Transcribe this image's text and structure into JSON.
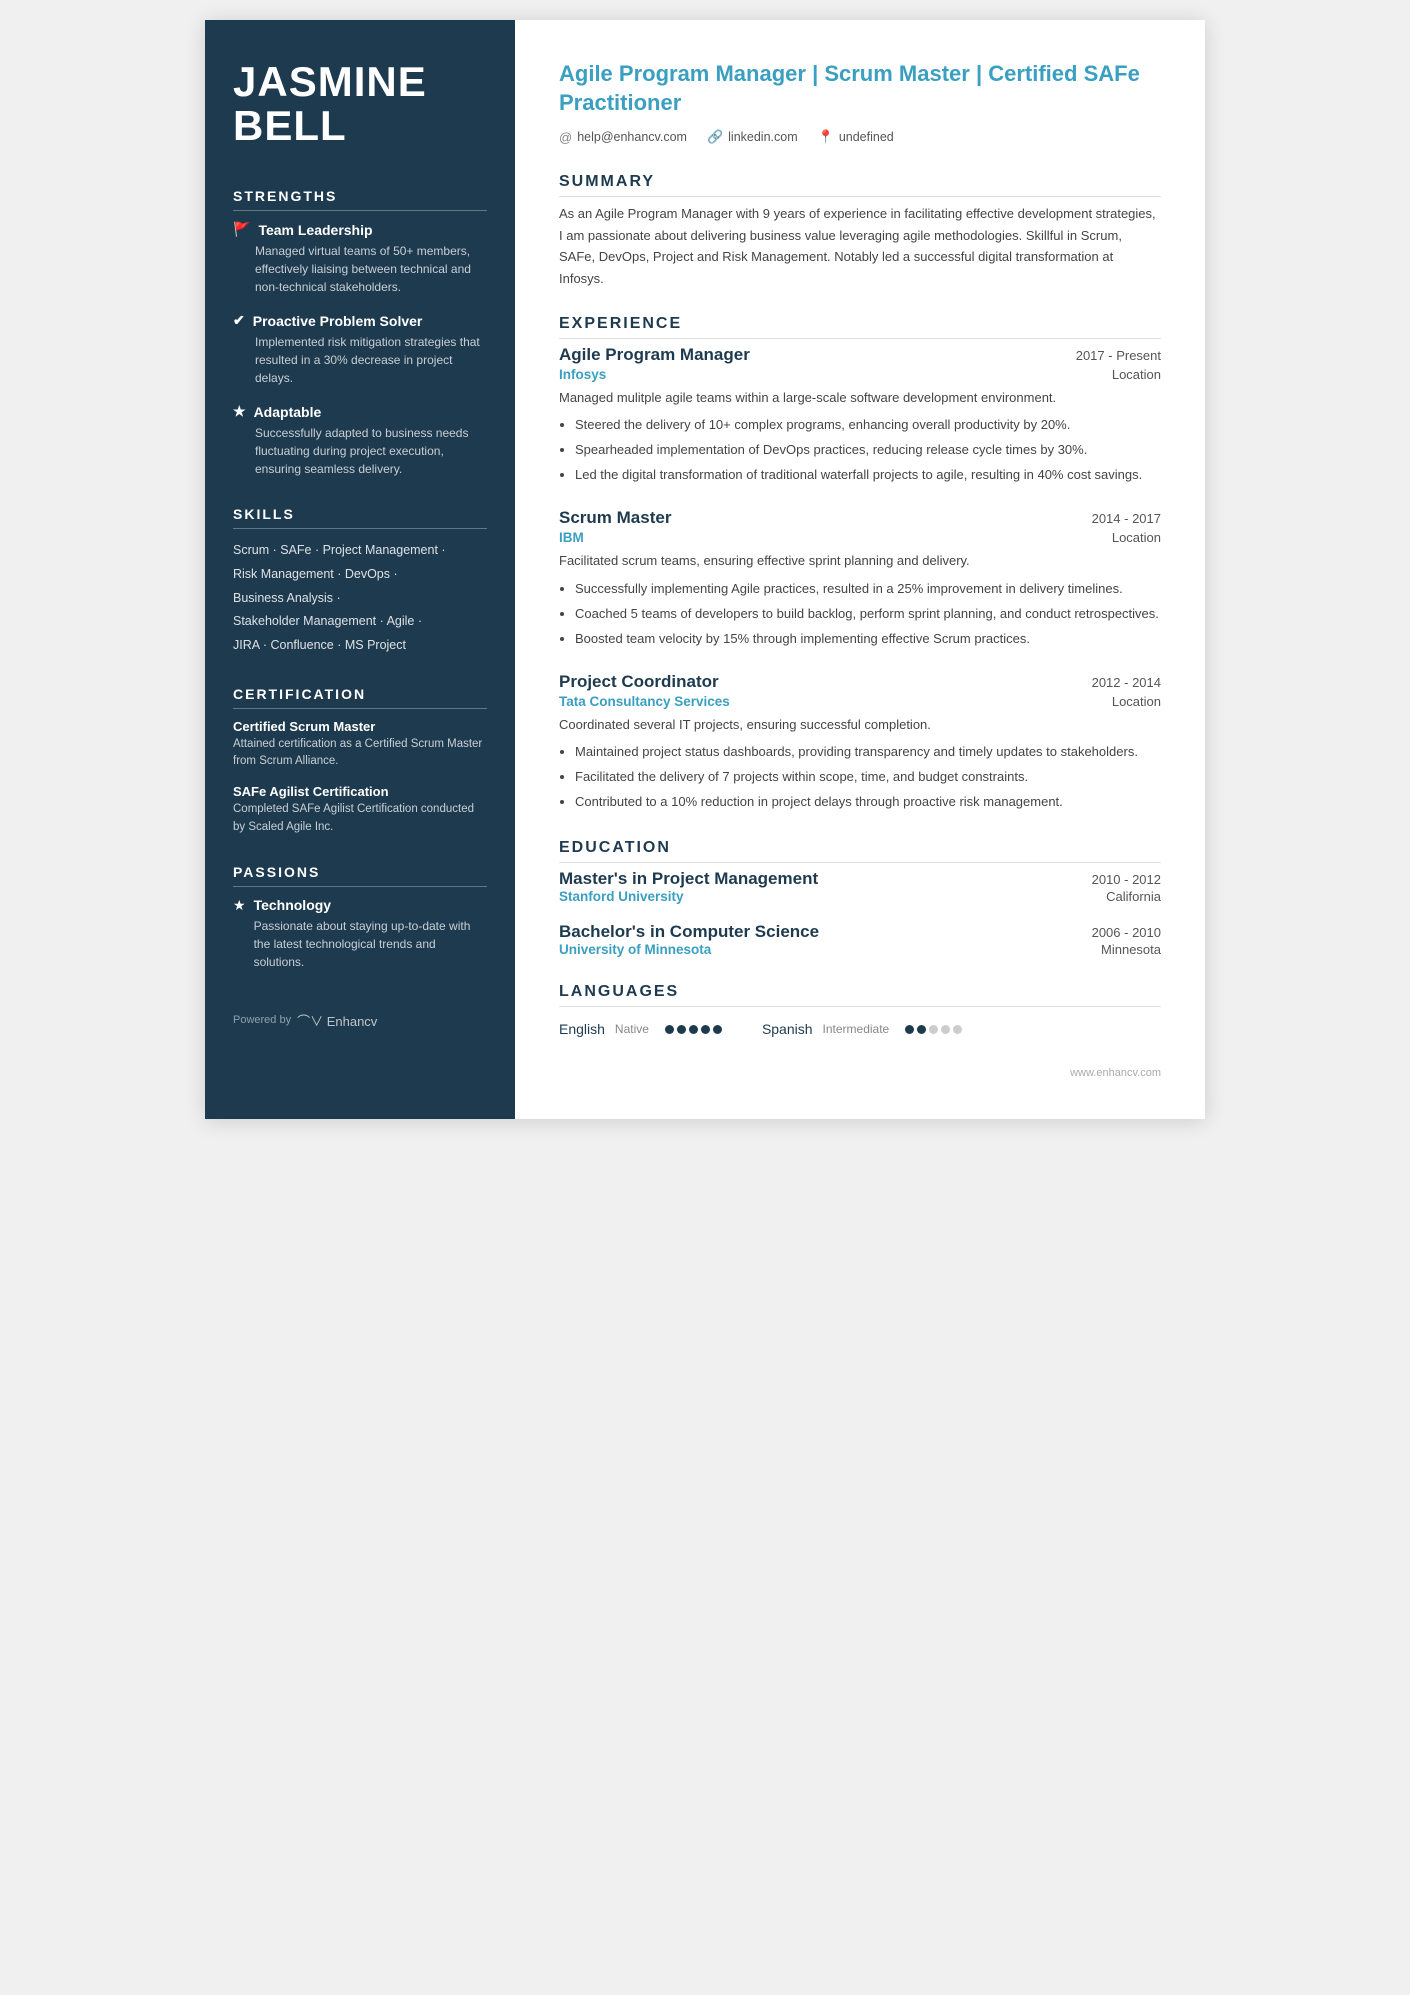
{
  "sidebar": {
    "name_line1": "JASMINE",
    "name_line2": "BELL",
    "strengths_title": "STRENGTHS",
    "strengths": [
      {
        "icon": "🚩",
        "title": "Team Leadership",
        "desc": "Managed virtual teams of 50+ members, effectively liaising between technical and non-technical stakeholders."
      },
      {
        "icon": "✔",
        "title": "Proactive Problem Solver",
        "desc": "Implemented risk mitigation strategies that resulted in a 30% decrease in project delays."
      },
      {
        "icon": "★",
        "title": "Adaptable",
        "desc": "Successfully adapted to business needs fluctuating during project execution, ensuring seamless delivery."
      }
    ],
    "skills_title": "SKILLS",
    "skills_lines": [
      "Scrum · SAFe · Project Management ·",
      "Risk Management · DevOps ·",
      "Business Analysis ·",
      "Stakeholder Management · Agile ·",
      "JIRA · Confluence · MS Project"
    ],
    "certification_title": "CERTIFICATION",
    "certifications": [
      {
        "name": "Certified Scrum Master",
        "desc": "Attained certification as a Certified Scrum Master from Scrum Alliance."
      },
      {
        "name": "SAFe Agilist Certification",
        "desc": "Completed SAFe Agilist Certification conducted by Scaled Agile Inc."
      }
    ],
    "passions_title": "PASSIONS",
    "passions": [
      {
        "icon": "★",
        "title": "Technology",
        "desc": "Passionate about staying up-to-date with the latest technological trends and solutions."
      }
    ],
    "powered_by": "Powered by",
    "logo": "⌒∨ Enhancv"
  },
  "main": {
    "title": "Agile Program Manager | Scrum Master | Certified SAFe Practitioner",
    "contact": {
      "email": "help@enhancv.com",
      "linkedin": "linkedin.com",
      "location": "undefined"
    },
    "summary_title": "SUMMARY",
    "summary": "As an Agile Program Manager with 9 years of experience in facilitating effective development strategies, I am passionate about delivering business value leveraging agile methodologies. Skillful in Scrum, SAFe, DevOps, Project and Risk Management. Notably led a successful digital transformation at Infosys.",
    "experience_title": "EXPERIENCE",
    "experiences": [
      {
        "title": "Agile Program Manager",
        "date": "2017 - Present",
        "company": "Infosys",
        "location": "Location",
        "desc": "Managed mulitple agile teams within a large-scale software development environment.",
        "bullets": [
          "Steered the delivery of 10+ complex programs, enhancing overall productivity by 20%.",
          "Spearheaded implementation of DevOps practices, reducing release cycle times by 30%.",
          "Led the digital transformation of traditional waterfall projects to agile, resulting in 40% cost savings."
        ]
      },
      {
        "title": "Scrum Master",
        "date": "2014 - 2017",
        "company": "IBM",
        "location": "Location",
        "desc": "Facilitated scrum teams, ensuring effective sprint planning and delivery.",
        "bullets": [
          "Successfully implementing Agile practices, resulted in a 25% improvement in delivery timelines.",
          "Coached 5 teams of developers to build backlog, perform sprint planning, and conduct retrospectives.",
          "Boosted team velocity by 15% through implementing effective Scrum practices."
        ]
      },
      {
        "title": "Project Coordinator",
        "date": "2012 - 2014",
        "company": "Tata Consultancy Services",
        "location": "Location",
        "desc": "Coordinated several IT projects, ensuring successful completion.",
        "bullets": [
          "Maintained project status dashboards, providing transparency and timely updates to stakeholders.",
          "Facilitated the delivery of 7 projects within scope, time, and budget constraints.",
          "Contributed to a 10% reduction in project delays through proactive risk management."
        ]
      }
    ],
    "education_title": "EDUCATION",
    "education": [
      {
        "degree": "Master's in Project Management",
        "date": "2010 - 2012",
        "school": "Stanford University",
        "location": "California"
      },
      {
        "degree": "Bachelor's in Computer Science",
        "date": "2006 - 2010",
        "school": "University of Minnesota",
        "location": "Minnesota"
      }
    ],
    "languages_title": "LANGUAGES",
    "languages": [
      {
        "name": "English",
        "level": "Native",
        "dots": 5,
        "filled": 5
      },
      {
        "name": "Spanish",
        "level": "Intermediate",
        "dots": 5,
        "filled": 2
      }
    ],
    "footer": "www.enhancv.com"
  }
}
